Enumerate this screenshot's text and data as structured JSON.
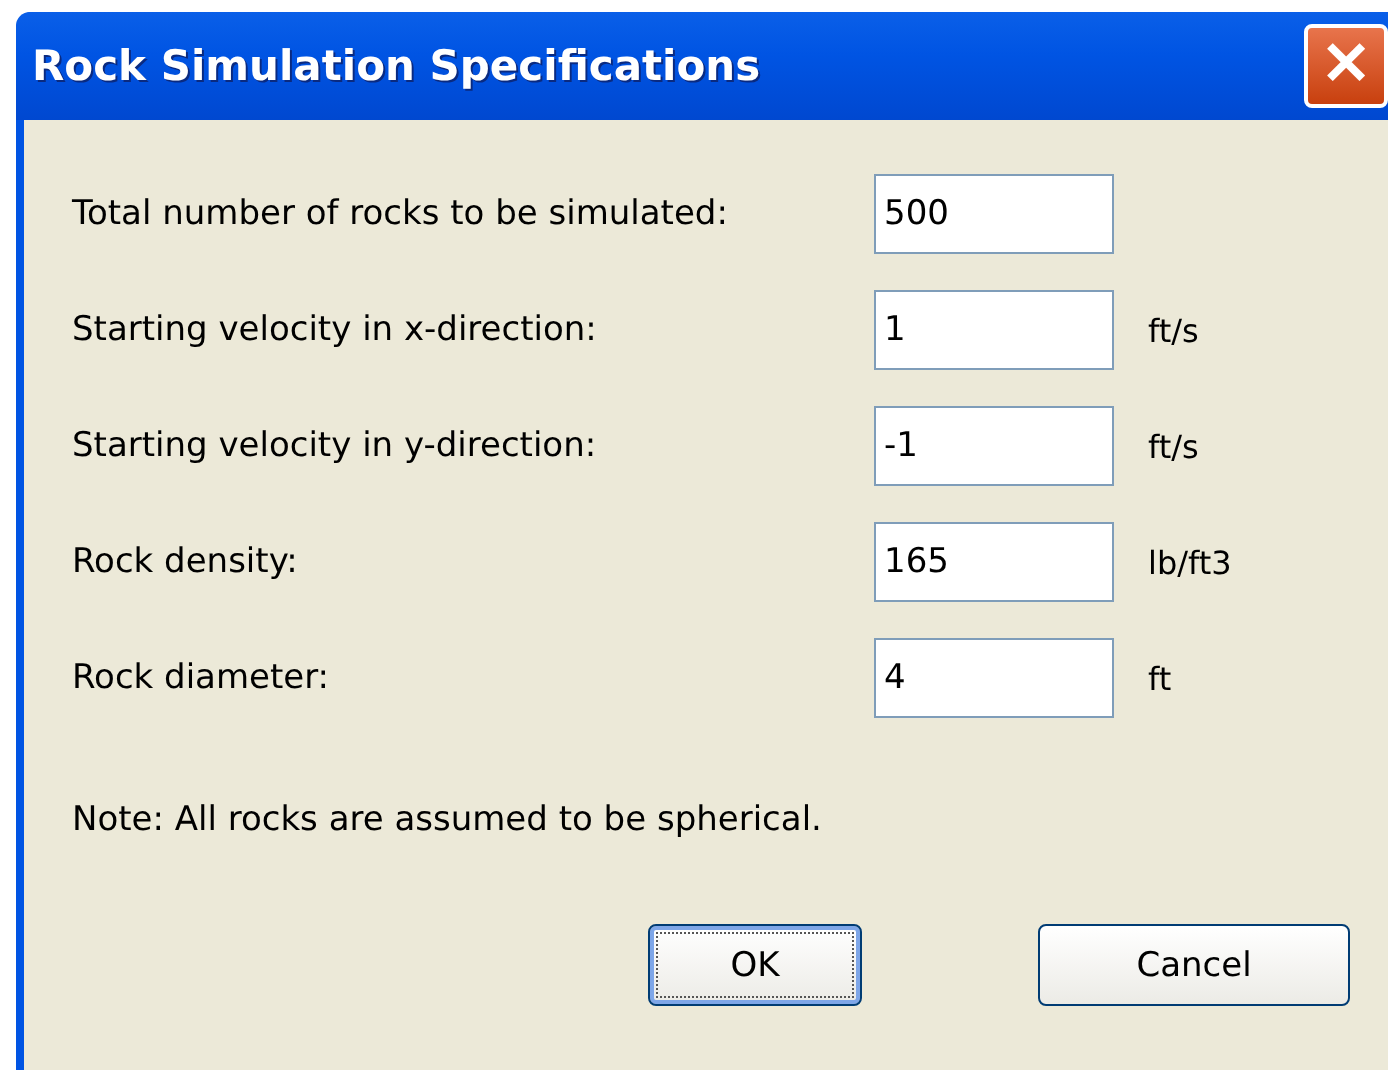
{
  "window": {
    "title": "Rock Simulation Specifications",
    "close": "✕"
  },
  "fields": [
    {
      "label": "Total number of rocks to be simulated:",
      "value": "500"
    },
    {
      "label": "Starting velocity in x-direction:",
      "value": "1",
      "unit": "ft/s"
    },
    {
      "label": "Starting velocity in y-direction:",
      "value": "-1",
      "unit": "ft/s"
    },
    {
      "label": "Rock density:",
      "value": "165",
      "unit": "lb/ft3"
    },
    {
      "label": "Rock diameter:",
      "value": "4",
      "unit": "ft"
    }
  ],
  "note": "Note: All rocks are assumed to be spherical.",
  "buttons": [
    {
      "label": "OK",
      "focused": true
    },
    {
      "label": "Cancel",
      "focused": false
    }
  ]
}
